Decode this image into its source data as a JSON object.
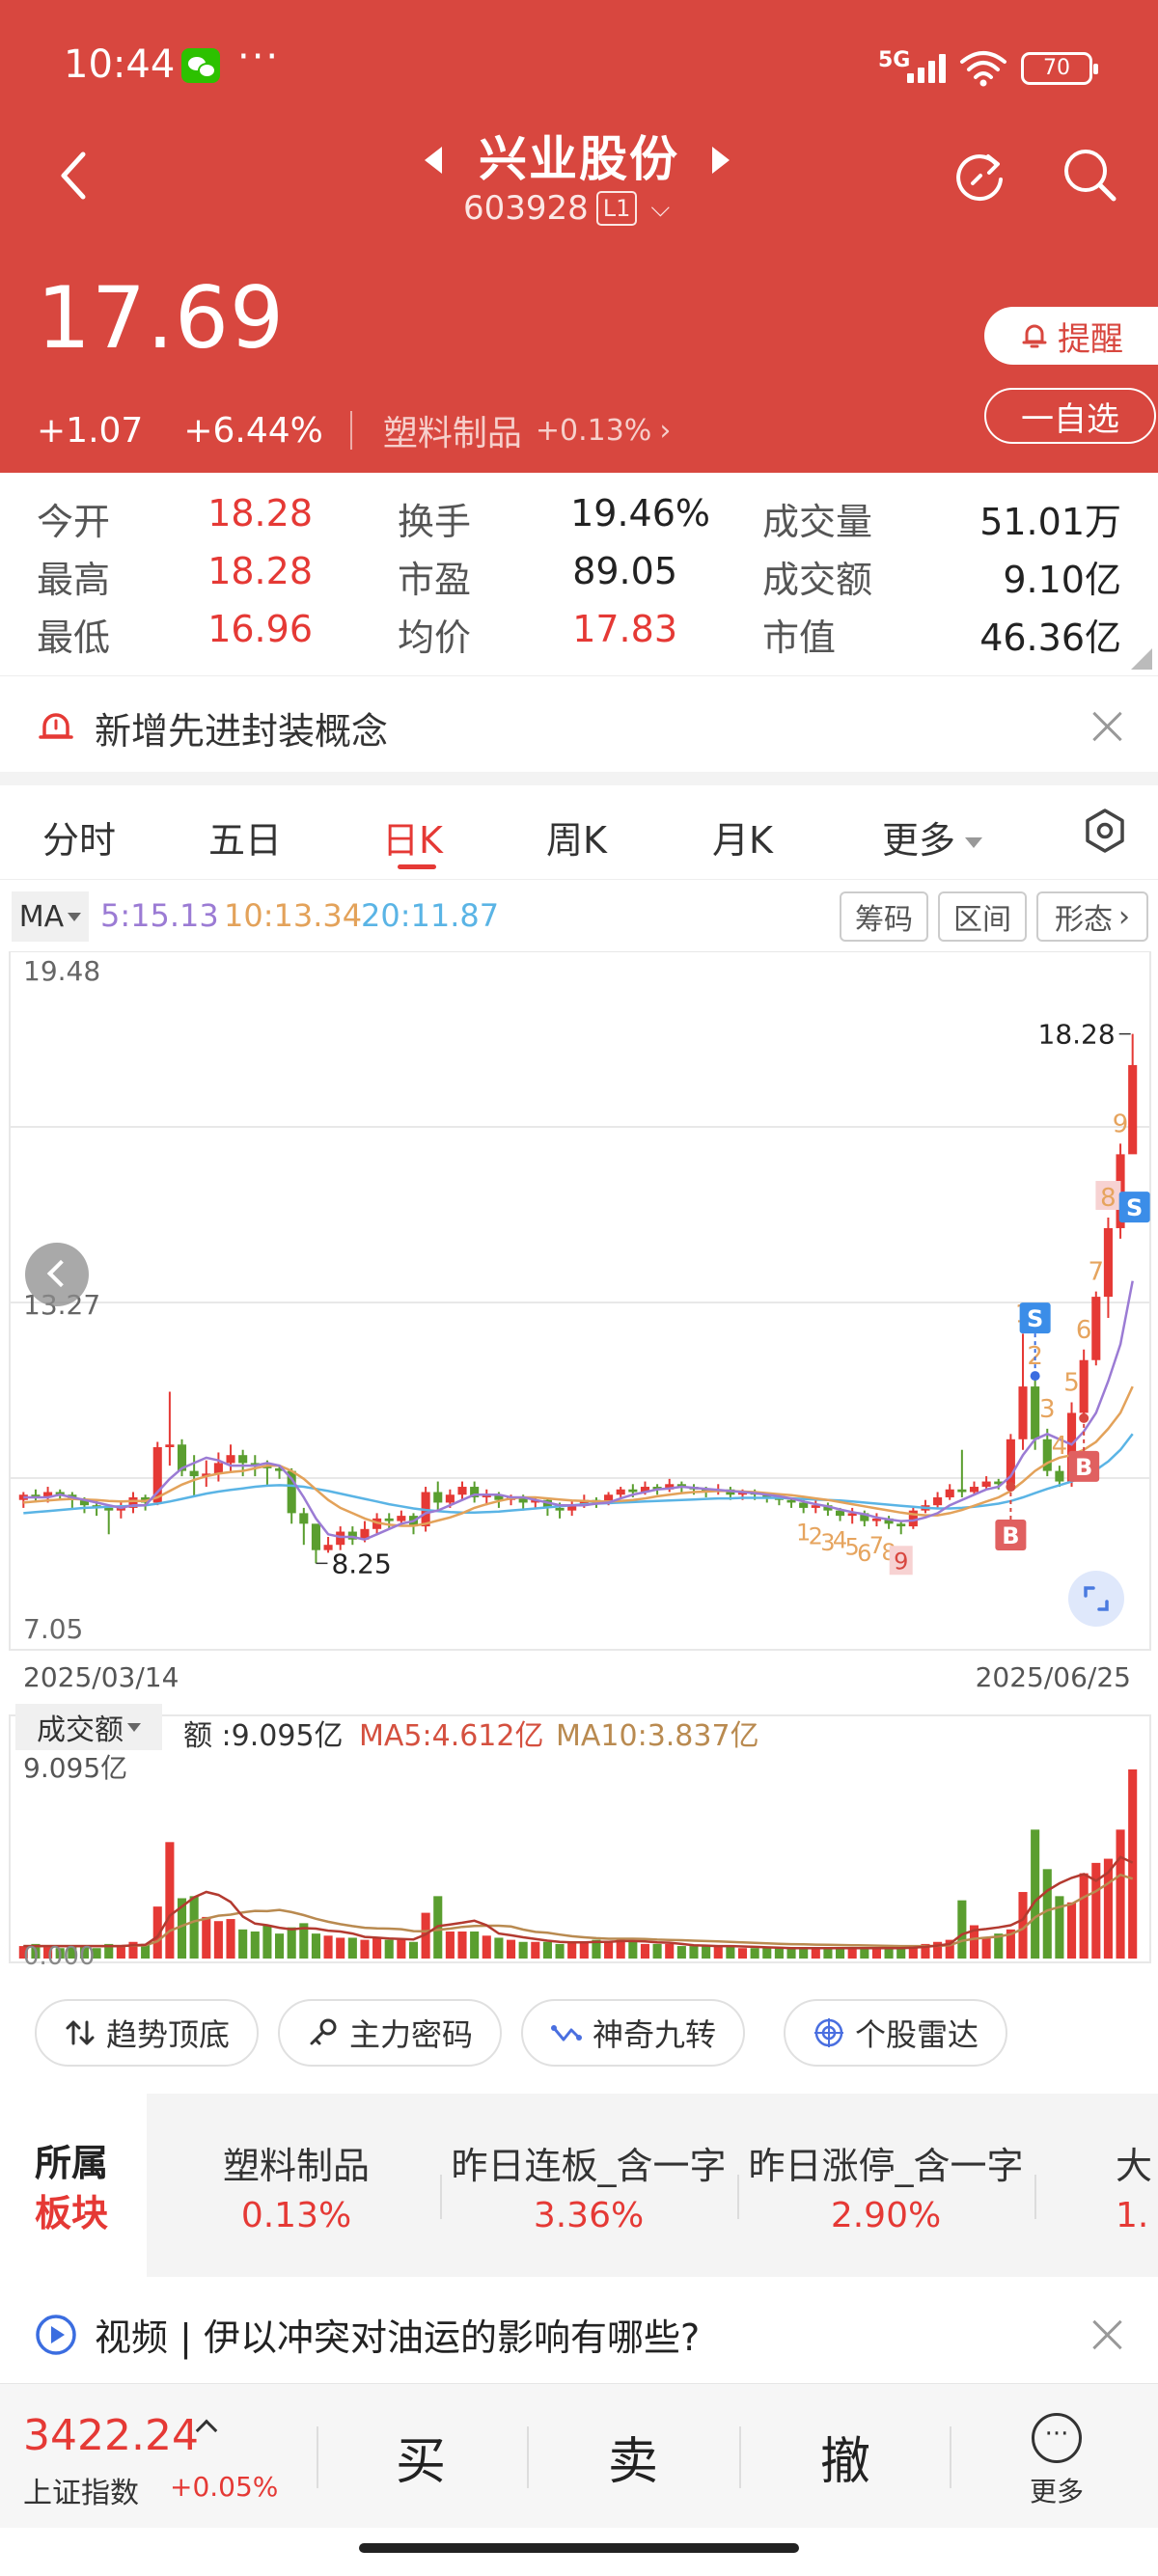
{
  "status_bar": {
    "time": "10:44",
    "dots": "···",
    "network": "5G",
    "battery": "70"
  },
  "header": {
    "stock_name": "兴业股份",
    "stock_code": "603928",
    "level": "L1",
    "price": "17.69",
    "change": "+1.07",
    "change_pct": "+6.44%",
    "sector": "塑料制品",
    "sector_pct": "+0.13%",
    "alert_label": "提醒",
    "watchlist_label": "一自选"
  },
  "stats": [
    {
      "label": "今开",
      "value": "18.28",
      "color": "red"
    },
    {
      "label": "换手",
      "value": "19.46%",
      "color": "dark"
    },
    {
      "label": "成交量",
      "value": "51.01万",
      "color": "dark"
    },
    {
      "label": "最高",
      "value": "18.28",
      "color": "red"
    },
    {
      "label": "市盈",
      "value": "89.05",
      "color": "dark"
    },
    {
      "label": "成交额",
      "value": "9.10亿",
      "color": "dark"
    },
    {
      "label": "最低",
      "value": "16.96",
      "color": "red"
    },
    {
      "label": "均价",
      "value": "17.83",
      "color": "red"
    },
    {
      "label": "市值",
      "value": "46.36亿",
      "color": "dark"
    }
  ],
  "news": {
    "text": "新增先进封装概念"
  },
  "tabs": [
    "分时",
    "五日",
    "日K",
    "周K",
    "月K",
    "更多"
  ],
  "active_tab": "日K",
  "ma": {
    "selector": "MA",
    "ma5": "5:15.13",
    "ma10": "10:13.34",
    "ma20": "20:11.87",
    "colors": {
      "ma5": "#9B7BD4",
      "ma10": "#E3A25A",
      "ma20": "#5AB4E5"
    }
  },
  "chart_tools": [
    "筹码",
    "区间",
    "形态"
  ],
  "chart_data": {
    "type": "candlestick",
    "y_max_label": "19.48",
    "y_mid_label": "13.27",
    "y_min_label": "7.05",
    "ylim": [
      7.05,
      19.48
    ],
    "x_start": "2025/03/14",
    "x_end": "2025/06/25",
    "high_annotation": "18.28",
    "low_annotation": "8.25",
    "colors": {
      "up": "#E53935",
      "down": "#5A9E2F"
    },
    "candles": [
      [
        9.45,
        9.55,
        9.3,
        9.6
      ],
      [
        9.55,
        9.5,
        9.4,
        9.65
      ],
      [
        9.5,
        9.6,
        9.4,
        9.7
      ],
      [
        9.6,
        9.55,
        9.45,
        9.65
      ],
      [
        9.55,
        9.45,
        9.3,
        9.6
      ],
      [
        9.45,
        9.35,
        9.2,
        9.5
      ],
      [
        9.35,
        9.3,
        9.15,
        9.45
      ],
      [
        9.3,
        9.25,
        8.8,
        9.35
      ],
      [
        9.25,
        9.3,
        9.1,
        9.4
      ],
      [
        9.3,
        9.5,
        9.2,
        9.6
      ],
      [
        9.5,
        9.4,
        9.25,
        9.55
      ],
      [
        9.4,
        10.45,
        9.35,
        10.55
      ],
      [
        10.45,
        10.5,
        10.1,
        11.5
      ],
      [
        10.5,
        10.0,
        9.9,
        10.6
      ],
      [
        10.0,
        9.9,
        9.5,
        10.3
      ],
      [
        9.9,
        9.95,
        9.7,
        10.2
      ],
      [
        9.95,
        10.15,
        9.8,
        10.35
      ],
      [
        10.15,
        10.3,
        10.0,
        10.5
      ],
      [
        10.3,
        10.15,
        9.9,
        10.4
      ],
      [
        10.15,
        10.1,
        9.9,
        10.3
      ],
      [
        10.1,
        10.05,
        9.7,
        10.2
      ],
      [
        10.05,
        10.0,
        9.85,
        10.1
      ],
      [
        10.0,
        9.2,
        9.0,
        10.05
      ],
      [
        9.2,
        9.0,
        8.6,
        9.3
      ],
      [
        9.0,
        8.5,
        8.25,
        8.6
      ],
      [
        8.5,
        8.6,
        8.45,
        8.75
      ],
      [
        8.6,
        8.85,
        8.5,
        8.95
      ],
      [
        8.85,
        8.7,
        8.6,
        8.95
      ],
      [
        8.7,
        8.9,
        8.65,
        9.05
      ],
      [
        8.9,
        9.1,
        8.8,
        9.2
      ],
      [
        9.1,
        9.05,
        8.9,
        9.2
      ],
      [
        9.05,
        9.15,
        8.95,
        9.25
      ],
      [
        9.15,
        8.95,
        8.8,
        9.2
      ],
      [
        8.95,
        9.6,
        8.85,
        9.7
      ],
      [
        9.6,
        9.4,
        9.25,
        9.8
      ],
      [
        9.4,
        9.55,
        9.3,
        9.65
      ],
      [
        9.55,
        9.7,
        9.45,
        9.8
      ],
      [
        9.7,
        9.5,
        9.4,
        9.8
      ],
      [
        9.5,
        9.55,
        9.35,
        9.65
      ],
      [
        9.55,
        9.45,
        9.3,
        9.6
      ],
      [
        9.45,
        9.5,
        9.35,
        9.55
      ],
      [
        9.5,
        9.4,
        9.25,
        9.55
      ],
      [
        9.4,
        9.45,
        9.3,
        9.5
      ],
      [
        9.45,
        9.3,
        9.15,
        9.5
      ],
      [
        9.3,
        9.25,
        9.1,
        9.4
      ],
      [
        9.25,
        9.35,
        9.15,
        9.45
      ],
      [
        9.35,
        9.45,
        9.3,
        9.55
      ],
      [
        9.45,
        9.4,
        9.3,
        9.5
      ],
      [
        9.4,
        9.55,
        9.35,
        9.6
      ],
      [
        9.55,
        9.65,
        9.5,
        9.7
      ],
      [
        9.65,
        9.6,
        9.5,
        9.75
      ],
      [
        9.6,
        9.7,
        9.55,
        9.8
      ],
      [
        9.7,
        9.65,
        9.55,
        9.75
      ],
      [
        9.65,
        9.75,
        9.6,
        9.85
      ],
      [
        9.75,
        9.7,
        9.6,
        9.8
      ],
      [
        9.7,
        9.65,
        9.55,
        9.75
      ],
      [
        9.65,
        9.6,
        9.5,
        9.7
      ],
      [
        9.6,
        9.65,
        9.55,
        9.75
      ],
      [
        9.65,
        9.55,
        9.45,
        9.7
      ],
      [
        9.55,
        9.6,
        9.45,
        9.65
      ],
      [
        9.6,
        9.55,
        9.45,
        9.65
      ],
      [
        9.55,
        9.5,
        9.4,
        9.6
      ],
      [
        9.5,
        9.45,
        9.35,
        9.55
      ],
      [
        9.45,
        9.4,
        9.3,
        9.5
      ],
      [
        9.4,
        9.3,
        9.2,
        9.45
      ],
      [
        9.3,
        9.35,
        9.2,
        9.45
      ],
      [
        9.35,
        9.25,
        9.15,
        9.4
      ],
      [
        9.25,
        9.15,
        9.05,
        9.3
      ],
      [
        9.15,
        9.2,
        9.0,
        9.3
      ],
      [
        9.2,
        9.05,
        8.95,
        9.25
      ],
      [
        9.05,
        9.1,
        8.95,
        9.2
      ],
      [
        9.1,
        9.0,
        8.9,
        9.15
      ],
      [
        9.0,
        8.95,
        8.8,
        9.05
      ],
      [
        8.95,
        9.25,
        8.9,
        9.3
      ],
      [
        9.25,
        9.35,
        9.2,
        9.45
      ],
      [
        9.35,
        9.5,
        9.3,
        9.6
      ],
      [
        9.5,
        9.65,
        9.45,
        9.75
      ],
      [
        9.65,
        9.6,
        9.5,
        10.4
      ],
      [
        9.6,
        9.7,
        9.55,
        9.8
      ],
      [
        9.7,
        9.8,
        9.65,
        9.9
      ],
      [
        9.8,
        9.75,
        9.65,
        9.85
      ],
      [
        9.75,
        10.6,
        9.7,
        10.7
      ],
      [
        10.6,
        11.6,
        10.4,
        12.6
      ],
      [
        11.6,
        10.6,
        10.4,
        11.8
      ],
      [
        10.6,
        10.0,
        9.9,
        10.8
      ],
      [
        10.0,
        9.8,
        9.7,
        10.1
      ],
      [
        9.8,
        11.1,
        9.7,
        11.3
      ],
      [
        11.1,
        12.1,
        11.0,
        12.3
      ],
      [
        12.1,
        13.3,
        12.0,
        13.4
      ],
      [
        13.3,
        14.6,
        12.9,
        14.8
      ],
      [
        14.6,
        16.0,
        14.4,
        16.2
      ],
      [
        16.0,
        17.69,
        16.96,
        18.28
      ]
    ],
    "ma5_line": [
      9.5,
      9.5,
      9.5,
      9.55,
      9.5,
      9.45,
      9.4,
      9.35,
      9.3,
      9.35,
      9.35,
      9.6,
      9.85,
      10.05,
      10.15,
      10.25,
      10.2,
      10.1,
      10.1,
      10.1,
      10.15,
      10.1,
      9.85,
      9.5,
      9.1,
      8.8,
      8.75,
      8.75,
      8.7,
      8.8,
      8.9,
      9.0,
      9.05,
      9.2,
      9.25,
      9.35,
      9.45,
      9.55,
      9.55,
      9.55,
      9.5,
      9.5,
      9.45,
      9.4,
      9.35,
      9.35,
      9.35,
      9.38,
      9.4,
      9.48,
      9.55,
      9.6,
      9.65,
      9.67,
      9.7,
      9.68,
      9.66,
      9.64,
      9.62,
      9.6,
      9.58,
      9.55,
      9.52,
      9.48,
      9.42,
      9.37,
      9.33,
      9.27,
      9.22,
      9.18,
      9.12,
      9.08,
      9.05,
      9.06,
      9.12,
      9.2,
      9.35,
      9.45,
      9.55,
      9.65,
      9.7,
      9.9,
      10.3,
      10.6,
      10.7,
      10.6,
      10.5,
      10.75,
      11.1,
      11.7,
      12.4,
      13.6
    ],
    "ma10_line": [
      9.4,
      9.42,
      9.44,
      9.46,
      9.47,
      9.46,
      9.45,
      9.43,
      9.42,
      9.43,
      9.43,
      9.5,
      9.62,
      9.74,
      9.83,
      9.9,
      9.95,
      9.98,
      10.0,
      10.05,
      10.1,
      10.1,
      10.0,
      9.85,
      9.65,
      9.45,
      9.3,
      9.2,
      9.1,
      9.02,
      8.98,
      8.96,
      8.96,
      9.0,
      9.06,
      9.12,
      9.2,
      9.3,
      9.37,
      9.43,
      9.48,
      9.5,
      9.5,
      9.48,
      9.46,
      9.44,
      9.43,
      9.42,
      9.42,
      9.43,
      9.45,
      9.48,
      9.52,
      9.55,
      9.58,
      9.6,
      9.61,
      9.62,
      9.62,
      9.61,
      9.6,
      9.58,
      9.56,
      9.54,
      9.51,
      9.48,
      9.45,
      9.41,
      9.37,
      9.33,
      9.29,
      9.25,
      9.21,
      9.18,
      9.16,
      9.16,
      9.2,
      9.26,
      9.34,
      9.42,
      9.5,
      9.62,
      9.8,
      10.0,
      10.15,
      10.25,
      10.3,
      10.4,
      10.55,
      10.8,
      11.1,
      11.6
    ],
    "ma20_line": [
      9.2,
      9.22,
      9.24,
      9.26,
      9.28,
      9.3,
      9.31,
      9.32,
      9.33,
      9.34,
      9.35,
      9.38,
      9.42,
      9.47,
      9.52,
      9.57,
      9.61,
      9.64,
      9.67,
      9.7,
      9.72,
      9.73,
      9.72,
      9.7,
      9.66,
      9.62,
      9.57,
      9.52,
      9.47,
      9.42,
      9.37,
      9.33,
      9.29,
      9.26,
      9.24,
      9.22,
      9.21,
      9.21,
      9.22,
      9.23,
      9.25,
      9.27,
      9.29,
      9.31,
      9.33,
      9.35,
      9.37,
      9.38,
      9.39,
      9.4,
      9.41,
      9.42,
      9.43,
      9.44,
      9.45,
      9.46,
      9.47,
      9.48,
      9.48,
      9.49,
      9.49,
      9.49,
      9.49,
      9.48,
      9.47,
      9.46,
      9.45,
      9.44,
      9.42,
      9.4,
      9.38,
      9.36,
      9.34,
      9.32,
      9.3,
      9.29,
      9.29,
      9.3,
      9.32,
      9.35,
      9.38,
      9.43,
      9.5,
      9.58,
      9.66,
      9.73,
      9.8,
      9.9,
      10.02,
      10.18,
      10.4,
      10.7
    ]
  },
  "nine_turn_labels": [
    "1",
    "2",
    "3",
    "4",
    "5",
    "6",
    "7",
    "8",
    "9"
  ],
  "signal_labels": {
    "sell": "S",
    "buy": "B"
  },
  "volume": {
    "selector": "成交额",
    "amount_label": "额 :9.095亿",
    "ma5_label": "MA5:4.612亿",
    "ma10_label": "MA10:3.837亿",
    "y_max_label": "9.095亿",
    "y_min_label": "0.000",
    "values": [
      0.6,
      0.7,
      0.6,
      0.5,
      0.6,
      0.6,
      0.5,
      0.7,
      0.6,
      0.8,
      0.7,
      2.5,
      5.6,
      2.9,
      3.0,
      2.0,
      1.8,
      1.9,
      1.4,
      1.3,
      1.6,
      1.2,
      1.5,
      1.7,
      1.2,
      1.1,
      1.0,
      1.0,
      0.9,
      1.0,
      0.9,
      0.9,
      0.8,
      2.2,
      3.0,
      1.3,
      1.3,
      1.3,
      1.1,
      1.0,
      0.9,
      0.8,
      0.8,
      0.8,
      0.7,
      0.8,
      0.8,
      0.9,
      0.8,
      0.9,
      0.8,
      0.7,
      0.7,
      0.7,
      0.6,
      0.6,
      0.6,
      0.6,
      0.6,
      0.5,
      0.5,
      0.5,
      0.5,
      0.5,
      0.5,
      0.5,
      0.5,
      0.5,
      0.5,
      0.5,
      0.5,
      0.5,
      0.5,
      0.6,
      0.7,
      0.8,
      0.9,
      2.8,
      1.6,
      1.0,
      1.2,
      1.4,
      3.2,
      6.2,
      4.3,
      3.0,
      2.7,
      4.1,
      4.6,
      4.8,
      6.2,
      9.095
    ],
    "vol_ma5": [
      0.6,
      0.6,
      0.6,
      0.6,
      0.6,
      0.6,
      0.6,
      0.6,
      0.6,
      0.64,
      0.66,
      1.06,
      2.06,
      2.5,
      2.94,
      3.2,
      3.06,
      2.72,
      2.02,
      1.68,
      1.6,
      1.48,
      1.4,
      1.46,
      1.44,
      1.34,
      1.3,
      1.2,
      1.04,
      1.0,
      0.96,
      0.94,
      0.92,
      1.16,
      1.56,
      1.64,
      1.72,
      1.82,
      1.6,
      1.2,
      1.12,
      1.02,
      0.94,
      0.86,
      0.8,
      0.78,
      0.78,
      0.8,
      0.8,
      0.84,
      0.84,
      0.82,
      0.78,
      0.76,
      0.7,
      0.64,
      0.62,
      0.6,
      0.6,
      0.58,
      0.56,
      0.54,
      0.52,
      0.5,
      0.5,
      0.5,
      0.5,
      0.5,
      0.5,
      0.5,
      0.5,
      0.5,
      0.5,
      0.52,
      0.56,
      0.62,
      0.7,
      1.16,
      1.36,
      1.42,
      1.5,
      1.6,
      1.88,
      2.76,
      3.26,
      3.62,
      3.88,
      4.06,
      3.74,
      4.14,
      4.88,
      4.612
    ],
    "vol_ma10": [
      0.6,
      0.6,
      0.6,
      0.6,
      0.6,
      0.6,
      0.6,
      0.6,
      0.6,
      0.62,
      0.63,
      0.83,
      1.33,
      1.57,
      1.79,
      1.92,
      2.06,
      2.11,
      2.22,
      2.29,
      2.28,
      2.34,
      2.23,
      2.09,
      1.91,
      1.77,
      1.65,
      1.56,
      1.48,
      1.45,
      1.44,
      1.41,
      1.32,
      1.31,
      1.38,
      1.44,
      1.52,
      1.57,
      1.58,
      1.58,
      1.54,
      1.39,
      1.28,
      1.24,
      1.15,
      1.07,
      1.02,
      0.98,
      0.95,
      0.95,
      0.95,
      0.94,
      0.91,
      0.89,
      0.88,
      0.86,
      0.84,
      0.82,
      0.8,
      0.78,
      0.75,
      0.73,
      0.71,
      0.69,
      0.68,
      0.67,
      0.66,
      0.65,
      0.64,
      0.63,
      0.62,
      0.61,
      0.6,
      0.6,
      0.6,
      0.61,
      0.64,
      0.85,
      0.95,
      1.0,
      1.06,
      1.17,
      1.43,
      1.98,
      2.31,
      2.48,
      2.62,
      2.95,
      3.24,
      3.62,
      4.03,
      3.837
    ]
  },
  "tool_chips": [
    {
      "label": "趋势顶底",
      "icon": "trend-arrows-icon"
    },
    {
      "label": "主力密码",
      "icon": "key-icon"
    },
    {
      "label": "神奇九转",
      "icon": "zigzag-icon"
    },
    {
      "label": "个股雷达",
      "icon": "radar-icon"
    }
  ],
  "sector_strip": {
    "title_line1": "所属",
    "title_line2": "板块",
    "items": [
      {
        "name": "塑料制品",
        "pct": "0.13%"
      },
      {
        "name": "昨日连板_含一字",
        "pct": "3.36%"
      },
      {
        "name": "昨日涨停_含一字",
        "pct": "2.90%"
      },
      {
        "name": "大",
        "pct": "1."
      }
    ]
  },
  "video": {
    "text": "视频 | 伊以冲突对油运的影响有哪些?"
  },
  "bottom_bar": {
    "index_value": "3422.24",
    "index_name": "上证指数",
    "index_pct": "+0.05%",
    "buy": "买",
    "sell": "卖",
    "cancel": "撤",
    "more": "更多"
  }
}
